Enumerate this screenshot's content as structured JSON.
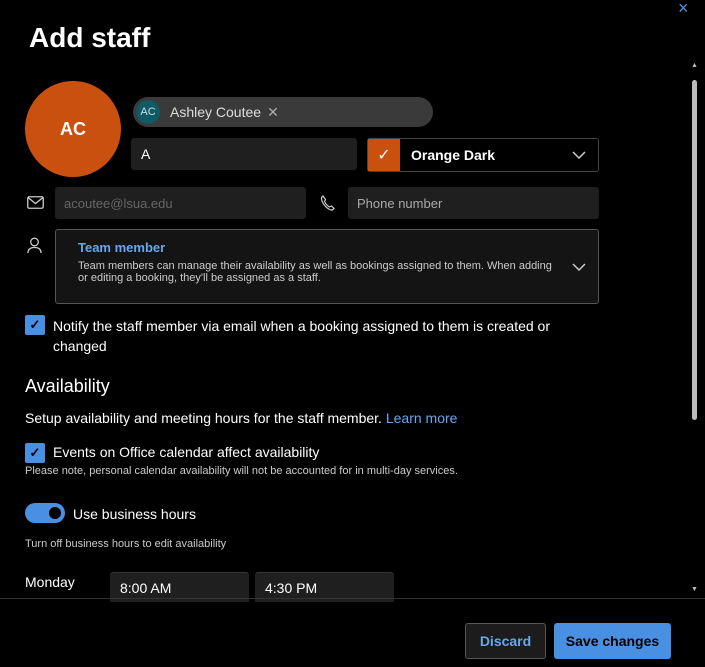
{
  "header": {
    "title": "Add staff",
    "close_icon": "×"
  },
  "staff": {
    "avatar_initials": "AC",
    "pill_initials": "AC",
    "name": "Ashley Coutee",
    "initials_value": "A",
    "color_name": "Orange Dark",
    "email_placeholder": "acoutee@lsua.edu",
    "phone_placeholder": "Phone number"
  },
  "role": {
    "title": "Team member",
    "description": "Team members can manage their availability as well as bookings assigned to them. When adding or editing a booking, they'll be assigned as a staff."
  },
  "notify_label": "Notify the staff member via email when a booking assigned to them is created or changed",
  "availability": {
    "heading": "Availability",
    "subtitle": "Setup availability and meeting hours for the staff member.",
    "learn_more": "Learn more",
    "events_label": "Events on Office calendar affect availability",
    "events_note": "Please note, personal calendar availability will not be accounted for in multi-day services.",
    "business_hours_label": "Use business hours",
    "business_hours_note": "Turn off business hours to edit availability",
    "day": "Monday",
    "start_time": "8:00 AM",
    "end_time": "4:30 PM"
  },
  "footer": {
    "discard": "Discard",
    "save": "Save changes"
  },
  "colors": {
    "accent": "#4a90e2",
    "avatar": "#ca5010",
    "background": "#000000"
  }
}
